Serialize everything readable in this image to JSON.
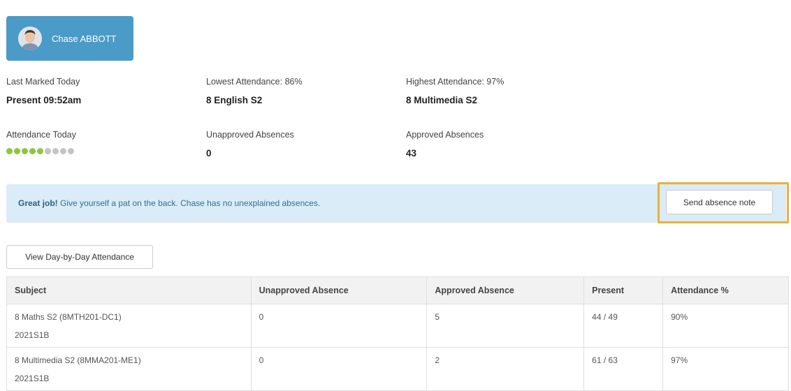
{
  "student": {
    "name": "Chase ABBOTT"
  },
  "stats": {
    "last_marked_label": "Last Marked Today",
    "last_marked_value": "Present 09:52am",
    "lowest_label": "Lowest Attendance: 86%",
    "lowest_value": "8 English S2",
    "highest_label": "Highest Attendance: 97%",
    "highest_value": "8 Multimedia S2",
    "today_label": "Attendance Today",
    "today_dots": {
      "attended": 5,
      "total": 9
    },
    "unapproved_label": "Unapproved Absences",
    "unapproved_value": "0",
    "approved_label": "Approved Absences",
    "approved_value": "43"
  },
  "alert": {
    "strong": "Great job!",
    "message": " Give yourself a pat on the back. Chase has no unexplained absences.",
    "button_label": "Send absence note"
  },
  "day_by_day_label": "View Day-by-Day Attendance",
  "table": {
    "headers": [
      "Subject",
      "Unapproved Absence",
      "Approved Absence",
      "Present",
      "Attendance %"
    ],
    "rows": [
      {
        "subject": "8 Maths S2 (8MTH201-DC1)",
        "term": "2021S1B",
        "unapproved": "0",
        "approved": "5",
        "present": "44 / 49",
        "percent": "90%"
      },
      {
        "subject": "8 Multimedia S2 (8MMA201-ME1)",
        "term": "2021S1B",
        "unapproved": "0",
        "approved": "2",
        "present": "61 / 63",
        "percent": "97%"
      }
    ]
  },
  "colors": {
    "card_blue": "#4a9bc7",
    "dot_on": "#8dc63f",
    "dot_off": "#c4c4c4",
    "alert_bg": "#d9ecf7",
    "highlight": "#e9b13a"
  }
}
